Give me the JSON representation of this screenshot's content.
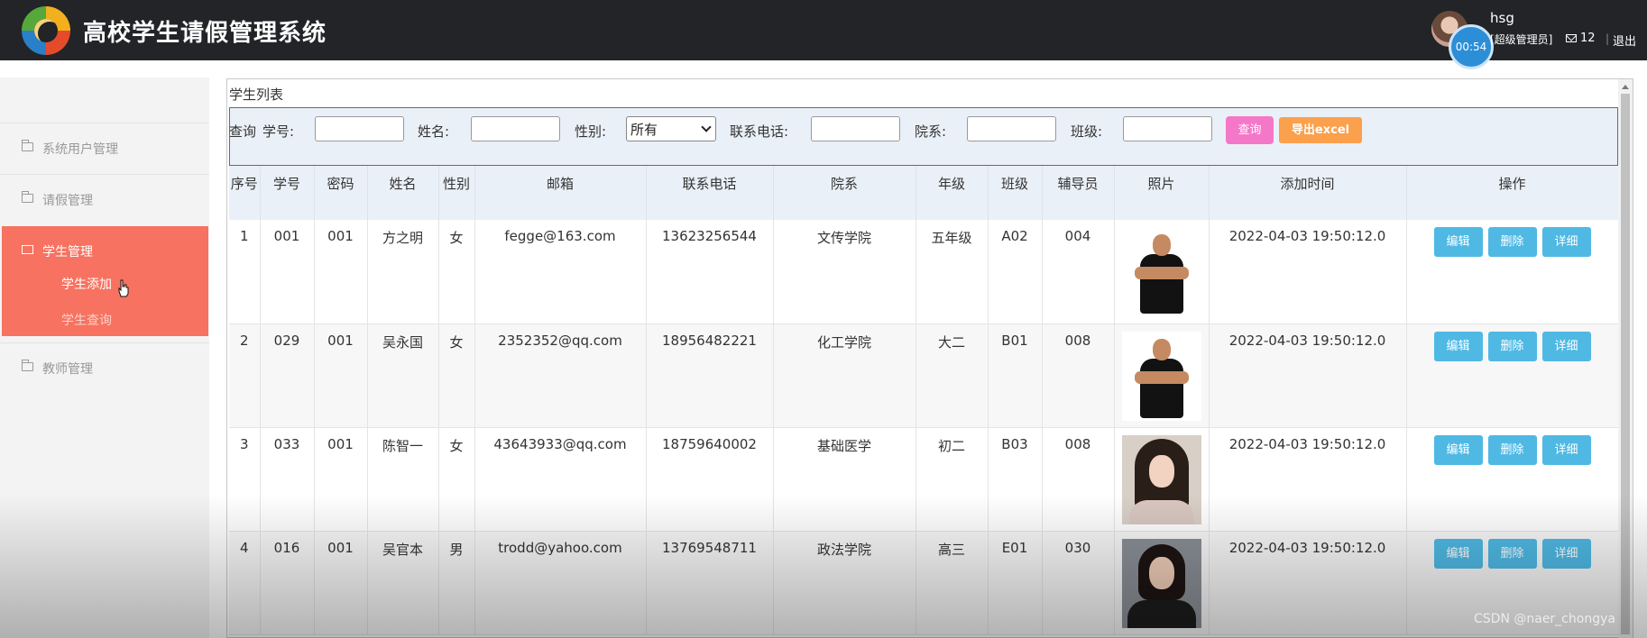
{
  "header": {
    "title": "高校学生请假管理系统",
    "timer": "00:54",
    "username": "hsg",
    "role": "[超级管理员]",
    "message_count": "12",
    "logout": "退出"
  },
  "sidebar": {
    "items": [
      {
        "label": "系统用户管理"
      },
      {
        "label": "请假管理"
      },
      {
        "label": "学生管理",
        "active": true,
        "children": [
          "学生添加",
          "学生查询"
        ]
      },
      {
        "label": "教师管理"
      }
    ]
  },
  "panel": {
    "title": "学生列表",
    "search": {
      "query_label": "查询",
      "student_no_label": "学号:",
      "name_label": "姓名:",
      "gender_label": "性别:",
      "gender_value": "所有",
      "phone_label": "联系电话:",
      "department_label": "院系:",
      "class_label": "班级:",
      "query_button": "查询",
      "export_button": "导出excel"
    },
    "columns": [
      "序号",
      "学号",
      "密码",
      "姓名",
      "性别",
      "邮箱",
      "联系电话",
      "院系",
      "年级",
      "班级",
      "辅导员",
      "照片",
      "添加时间",
      "操作"
    ],
    "rows": [
      {
        "seq": "1",
        "student_no": "001",
        "password": "001",
        "name": "方之明",
        "gender": "女",
        "email": "fegge@163.com",
        "phone": "13623256544",
        "department": "文传学院",
        "grade": "五年级",
        "class": "A02",
        "counselor": "004",
        "photo": "male-photo",
        "added": "2022-04-03 19:50:12.0"
      },
      {
        "seq": "2",
        "student_no": "029",
        "password": "001",
        "name": "吴永国",
        "gender": "女",
        "email": "2352352@qq.com",
        "phone": "18956482221",
        "department": "化工学院",
        "grade": "大二",
        "class": "B01",
        "counselor": "008",
        "photo": "male-photo",
        "added": "2022-04-03 19:50:12.0"
      },
      {
        "seq": "3",
        "student_no": "033",
        "password": "001",
        "name": "陈智一",
        "gender": "女",
        "email": "43643933@qq.com",
        "phone": "18759640002",
        "department": "基础医学",
        "grade": "初二",
        "class": "B03",
        "counselor": "008",
        "photo": "female-photo",
        "added": "2022-04-03 19:50:12.0"
      },
      {
        "seq": "4",
        "student_no": "016",
        "password": "001",
        "name": "吴官本",
        "gender": "男",
        "email": "trodd@yahoo.com",
        "phone": "13769548711",
        "department": "政法学院",
        "grade": "高三",
        "class": "E01",
        "counselor": "030",
        "photo": "woman-portrait",
        "added": "2022-04-03 19:50:12.0"
      }
    ],
    "actions": {
      "edit": "编辑",
      "delete": "删除",
      "detail": "详细"
    }
  },
  "watermark": "CSDN @naer_chongya",
  "colors": {
    "header_bg": "#222427",
    "sidebar_active": "#f77260",
    "query_button": "#f577c8",
    "export_button": "#fba04c",
    "action_button": "#4fb9e4"
  }
}
